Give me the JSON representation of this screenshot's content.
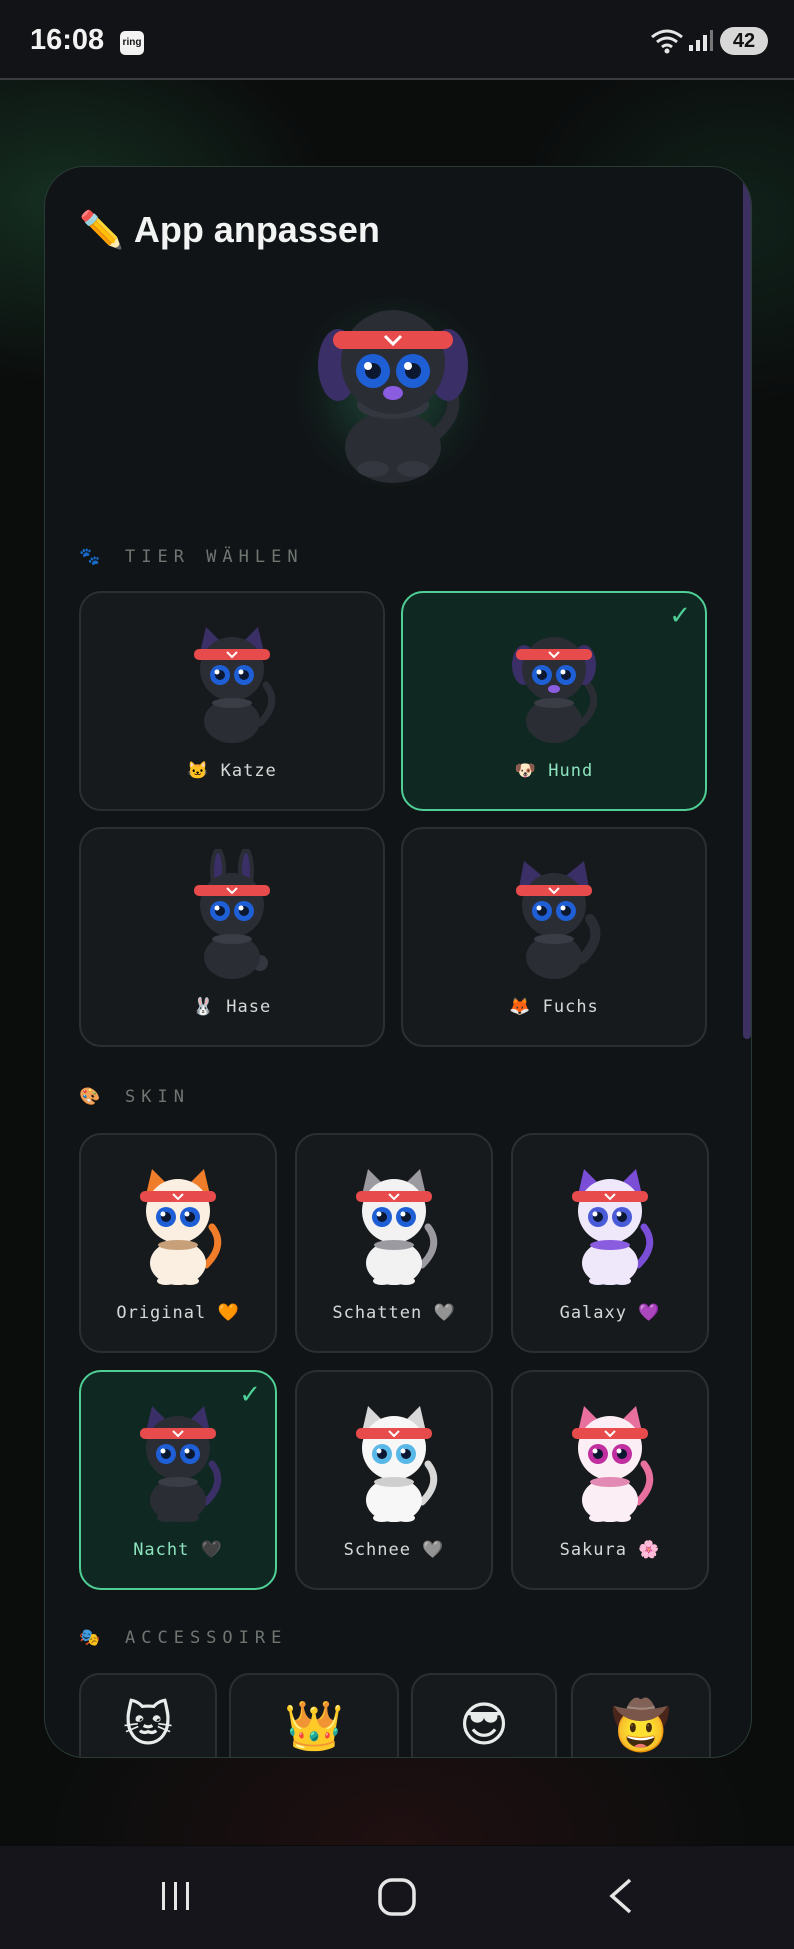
{
  "status_bar": {
    "time": "16:08",
    "app_badge": "ring",
    "battery": "42"
  },
  "panel": {
    "title": "App anpassen",
    "title_icon": "pencil-emoji",
    "title_emoji": "✏️"
  },
  "sections": {
    "animal": {
      "label": "TIER WÄHLEN",
      "icon": "🐾"
    },
    "skin": {
      "label": "SKIN",
      "icon": "🎨"
    },
    "accessory": {
      "label": "ACCESSOIRE",
      "icon": "🎭"
    }
  },
  "animals": [
    {
      "emoji": "🐱",
      "name": "Katze",
      "selected": false
    },
    {
      "emoji": "🐶",
      "name": "Hund",
      "selected": true
    },
    {
      "emoji": "🐰",
      "name": "Hase",
      "selected": false
    },
    {
      "emoji": "🦊",
      "name": "Fuchs",
      "selected": false
    }
  ],
  "skins": [
    {
      "name": "Original",
      "emoji": "🧡",
      "selected": false,
      "body": "#fbefe2",
      "ear": "#ef7d2a",
      "eye": "#1f5fd6",
      "collar": "#c7a07a"
    },
    {
      "name": "Schatten",
      "emoji": "🩶",
      "selected": false,
      "body": "#f2f2f2",
      "ear": "#9a9aa0",
      "eye": "#1f5fd6",
      "collar": "#9a9aa0"
    },
    {
      "name": "Galaxy",
      "emoji": "💜",
      "selected": false,
      "body": "#efe8fb",
      "ear": "#7b4ed8",
      "eye": "#4a5bd8",
      "collar": "#8a5ce0"
    },
    {
      "name": "Nacht",
      "emoji": "🖤",
      "selected": true,
      "body": "#2a2d34",
      "ear": "#3a2f66",
      "eye": "#1f5fd6",
      "collar": "#3a3d45"
    },
    {
      "name": "Schnee",
      "emoji": "🩶",
      "selected": false,
      "body": "#f7f7f7",
      "ear": "#d8d8d8",
      "eye": "#5ab8e8",
      "collar": "#cfcfcf"
    },
    {
      "name": "Sakura",
      "emoji": "🌸",
      "selected": false,
      "body": "#fbeef4",
      "ear": "#e8709e",
      "eye": "#c02ea0",
      "collar": "#e38ab4"
    }
  ],
  "accessories": [
    {
      "emoji": "🐱",
      "icon": "cat-face-icon"
    },
    {
      "emoji": "👑",
      "icon": "crown-icon"
    },
    {
      "emoji": "😎",
      "icon": "sunglasses-icon"
    },
    {
      "emoji": "🤠",
      "icon": "cowboy-hat-icon"
    }
  ],
  "colors": {
    "accent": "#4fcf95",
    "panel_bg": "#111416",
    "card_bg": "#171a1d",
    "headband": "#e84b4b",
    "pet_dark": "#2a2d34"
  }
}
